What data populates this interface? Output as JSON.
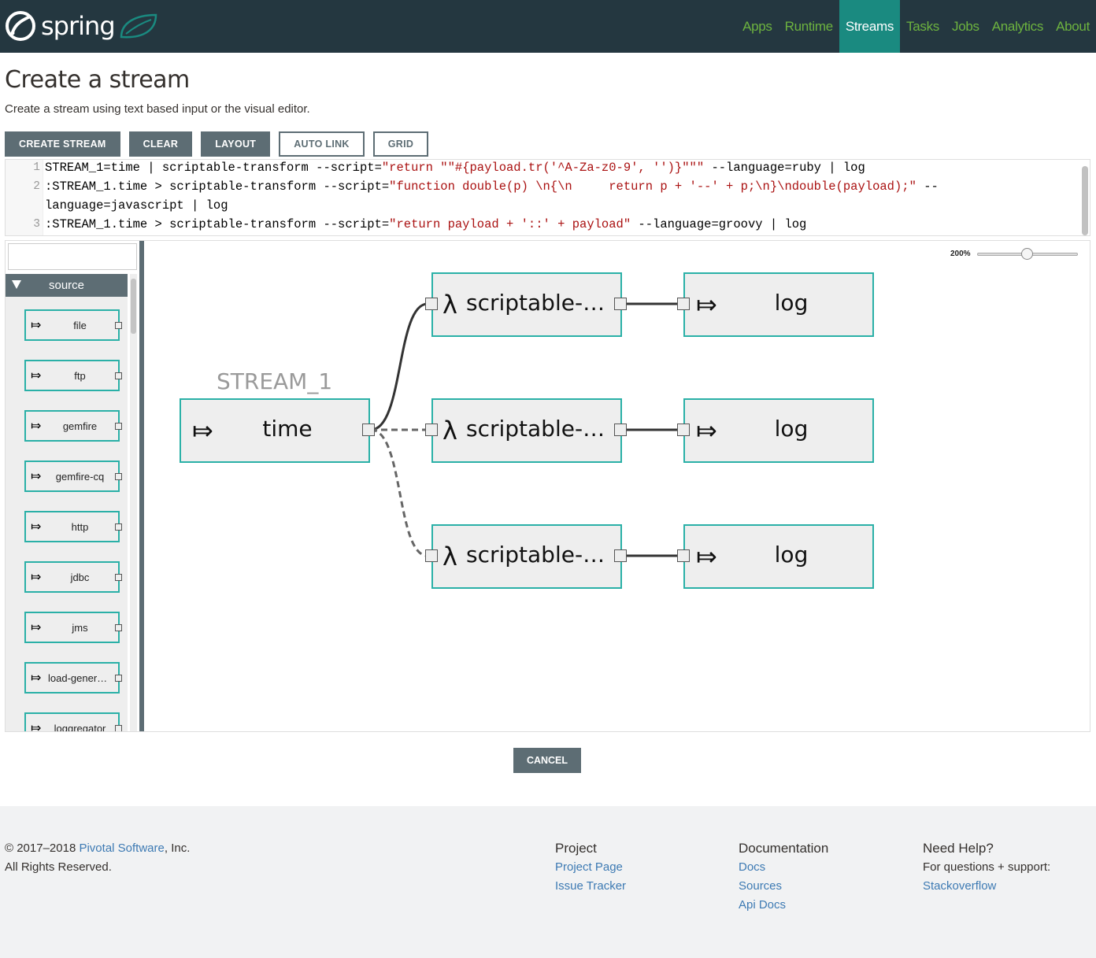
{
  "header": {
    "brand": "spring",
    "nav": [
      {
        "label": "Apps"
      },
      {
        "label": "Runtime"
      },
      {
        "label": "Streams",
        "active": true
      },
      {
        "label": "Tasks"
      },
      {
        "label": "Jobs"
      },
      {
        "label": "Analytics"
      },
      {
        "label": "About"
      }
    ]
  },
  "page": {
    "title": "Create a stream",
    "subtitle": "Create a stream using text based input or the visual editor."
  },
  "toolbar": {
    "create_stream": "CREATE STREAM",
    "clear": "CLEAR",
    "layout": "LAYOUT",
    "auto_link": "AUTO LINK",
    "grid": "GRID"
  },
  "editor": {
    "line_numbers": [
      "1",
      "2",
      "3"
    ],
    "lines": [
      {
        "pre": "STREAM_1=time | scriptable-transform --script=",
        "str": "\"return \"\"#{payload.tr('^A-Za-z0-9', '')}\"\"\"",
        "post": " --language=ruby | log"
      },
      {
        "pre": ":STREAM_1.time > scriptable-transform --script=",
        "str": "\"function double(p) \\n{\\n     return p + '--' + p;\\n}\\ndouble(payload);\"",
        "post": " --"
      },
      {
        "pre": "language=javascript | log",
        "str": "",
        "post": ""
      },
      {
        "pre": ":STREAM_1.time > scriptable-transform --script=",
        "str": "\"return payload + '::' + payload\"",
        "post": " --language=groovy | log"
      }
    ]
  },
  "palette": {
    "search_value": "",
    "group": "source",
    "items": [
      "file",
      "ftp",
      "gemfire",
      "gemfire-cq",
      "http",
      "jdbc",
      "jms",
      "load-generator",
      "loggregator"
    ],
    "source_icon": "⤇"
  },
  "canvas": {
    "zoom": "200%",
    "zoom_level": 1.0,
    "stream_name": "STREAM_1",
    "source_node": {
      "icon": "⤇",
      "label": "time"
    },
    "processor_icon": "λ",
    "sink_icon": "⤇",
    "processors": [
      "scriptable-transform",
      "scriptable-transform",
      "scriptable-transform"
    ],
    "sinks": [
      "log",
      "log",
      "log"
    ]
  },
  "cancel": "CANCEL",
  "footer": {
    "copyright_prefix": "© 2017–2018 ",
    "copyright_link": "Pivotal Software",
    "copyright_suffix": ", Inc.",
    "rights": "All Rights Reserved.",
    "project": {
      "heading": "Project",
      "links": [
        "Project Page",
        "Issue Tracker"
      ]
    },
    "documentation": {
      "heading": "Documentation",
      "links": [
        "Docs",
        "Sources",
        "Api Docs"
      ]
    },
    "help": {
      "heading": "Need Help?",
      "text": "For questions + support:",
      "link": "Stackoverflow"
    }
  },
  "colors": {
    "header_bg": "#243740",
    "nav_link": "#6db33f",
    "nav_active_bg": "#1a8a80",
    "node_border": "#2ab0a7",
    "button_bg": "#5d6d74",
    "footer_link": "#3d7ab3"
  }
}
